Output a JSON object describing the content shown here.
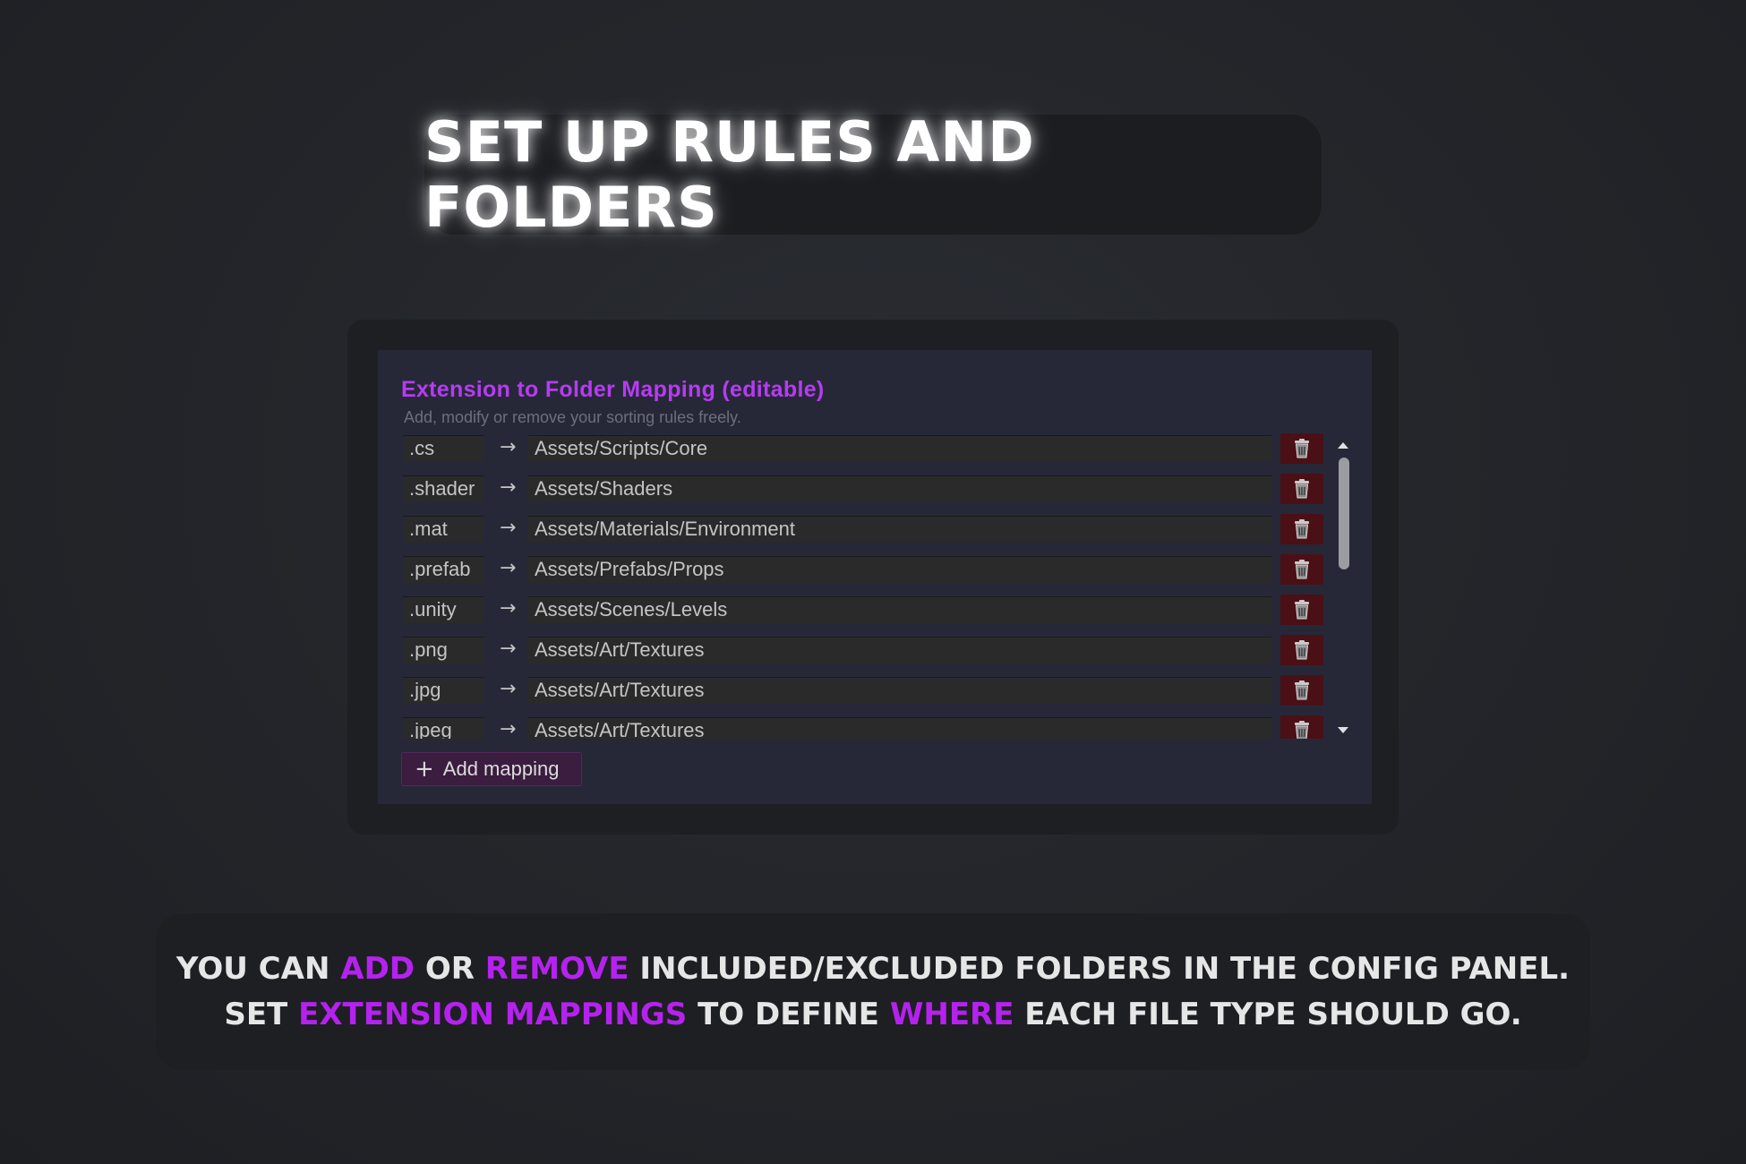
{
  "title": "SET UP RULES AND FOLDERS",
  "panel": {
    "heading": "Extension to Folder Mapping (editable)",
    "subtitle": "Add, modify or remove your sorting rules freely.",
    "arrow_glyph": "→",
    "mappings": [
      {
        "ext": ".cs",
        "path": "Assets/Scripts/Core"
      },
      {
        "ext": ".shader",
        "path": "Assets/Shaders"
      },
      {
        "ext": ".mat",
        "path": "Assets/Materials/Environment"
      },
      {
        "ext": ".prefab",
        "path": "Assets/Prefabs/Props"
      },
      {
        "ext": ".unity",
        "path": "Assets/Scenes/Levels"
      },
      {
        "ext": ".png",
        "path": "Assets/Art/Textures"
      },
      {
        "ext": ".jpg",
        "path": "Assets/Art/Textures"
      },
      {
        "ext": ".jpeg",
        "path": "Assets/Art/Textures"
      }
    ],
    "delete_icon": "trash-icon",
    "add_button": {
      "icon": "plus-icon",
      "label": "Add mapping"
    },
    "scrollbar": {
      "position_fraction": 0.0
    }
  },
  "caption": {
    "line1": [
      {
        "text": "YOU CAN ",
        "highlight": false
      },
      {
        "text": "ADD",
        "highlight": true
      },
      {
        "text": " OR ",
        "highlight": false
      },
      {
        "text": "REMOVE",
        "highlight": true
      },
      {
        "text": " INCLUDED/EXCLUDED FOLDERS IN THE CONFIG PANEL.",
        "highlight": false
      }
    ],
    "line2": [
      {
        "text": "SET ",
        "highlight": false
      },
      {
        "text": "EXTENSION MAPPINGS",
        "highlight": true
      },
      {
        "text": " TO DEFINE ",
        "highlight": false
      },
      {
        "text": "WHERE",
        "highlight": true
      },
      {
        "text": " EACH FILE TYPE SHOULD GO.",
        "highlight": false
      }
    ]
  },
  "colors": {
    "accent": "#b522ee",
    "heading": "#b63cf0",
    "delete_bg": "#4a1016",
    "panel_bg": "#262838"
  }
}
